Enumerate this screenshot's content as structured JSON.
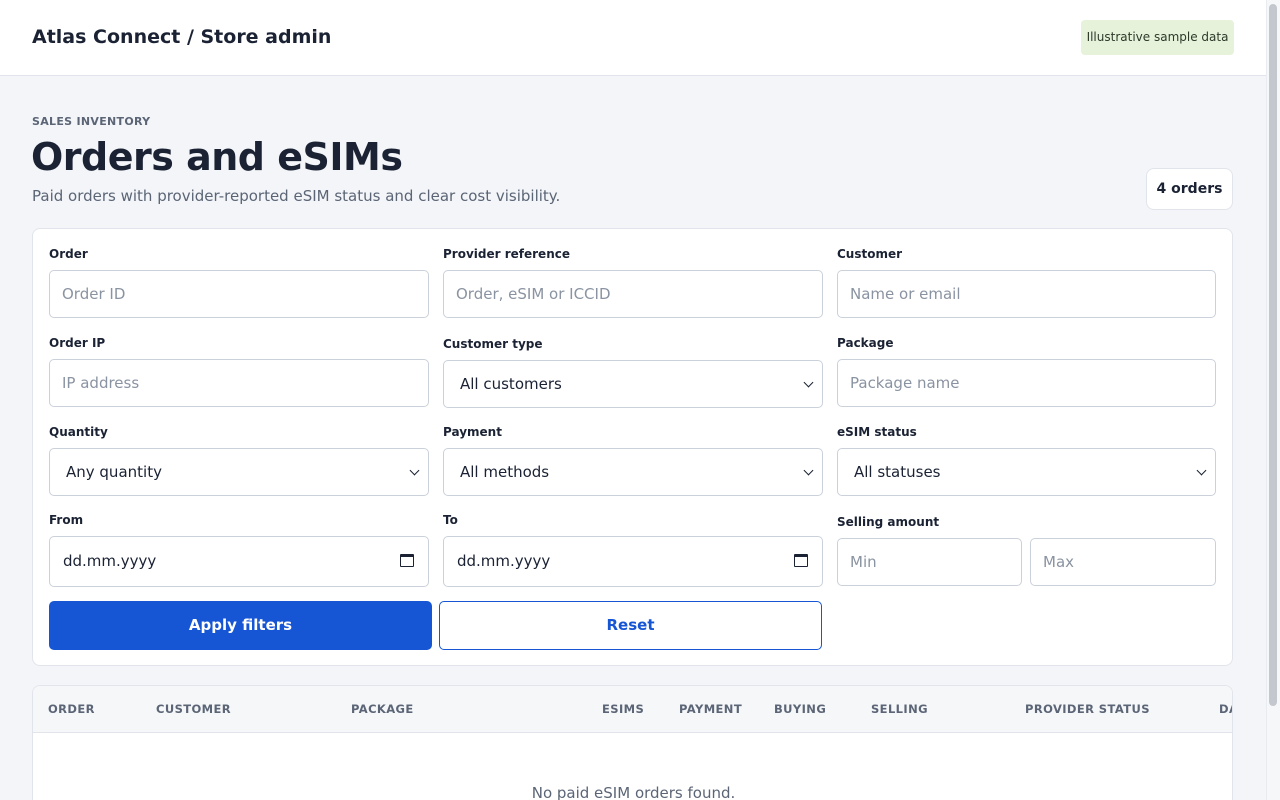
{
  "header": {
    "brand": "Atlas Connect / Store admin",
    "sample_badge": "Illustrative sample data"
  },
  "page": {
    "eyebrow": "SALES INVENTORY",
    "title": "Orders and eSIMs",
    "subtitle": "Paid orders with provider-reported eSIM status and clear cost visibility.",
    "count_badge": "4 orders"
  },
  "filters": {
    "order": {
      "label": "Order",
      "placeholder": "Order ID"
    },
    "provider_reference": {
      "label": "Provider reference",
      "placeholder": "Order, eSIM or ICCID"
    },
    "customer": {
      "label": "Customer",
      "placeholder": "Name or email"
    },
    "order_ip": {
      "label": "Order IP",
      "placeholder": "IP address"
    },
    "customer_type": {
      "label": "Customer type",
      "value": "All customers"
    },
    "package": {
      "label": "Package",
      "placeholder": "Package name"
    },
    "quantity": {
      "label": "Quantity",
      "value": "Any quantity"
    },
    "payment": {
      "label": "Payment",
      "value": "All methods"
    },
    "esim_status": {
      "label": "eSIM status",
      "value": "All statuses"
    },
    "from": {
      "label": "From",
      "value": "dd.mm.yyyy"
    },
    "to": {
      "label": "To",
      "value": "dd.mm.yyyy"
    },
    "selling_amount": {
      "label": "Selling amount",
      "min_placeholder": "Min",
      "max_placeholder": "Max"
    },
    "apply_label": "Apply filters",
    "reset_label": "Reset"
  },
  "table": {
    "columns": [
      "ORDER",
      "CUSTOMER",
      "PACKAGE",
      "ESIMS",
      "PAYMENT",
      "BUYING",
      "SELLING",
      "PROVIDER STATUS",
      "DA"
    ],
    "empty_message": "No paid eSIM orders found."
  },
  "colors": {
    "accent": "#1656d4",
    "badge_bg": "#e6f2da",
    "page_bg": "#f3f5f8"
  },
  "icons": {
    "select": "chevron-down-icon",
    "date": "calendar-icon"
  }
}
